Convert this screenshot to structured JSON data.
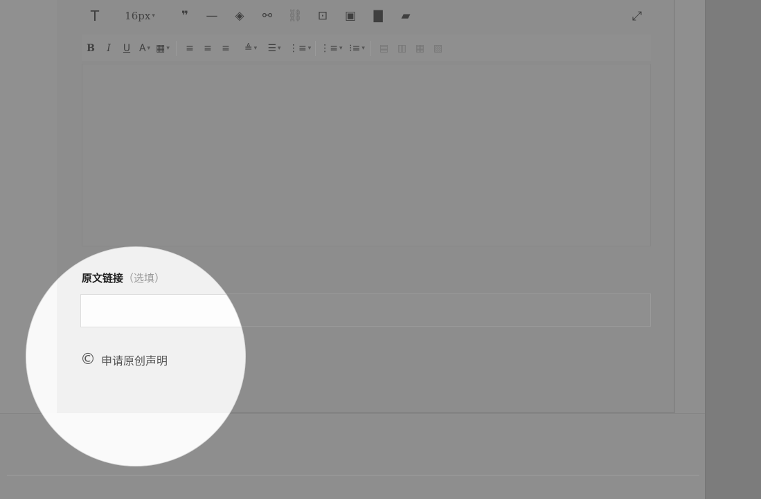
{
  "toolbar": {
    "text_icon": "T",
    "font_size": "16px",
    "font_size_caret": "▾",
    "quote_icon": "❞",
    "hr_icon": "—",
    "eraser_icon": "◈",
    "link_icon": "⚯",
    "unlink_icon": "⛓",
    "video_icon": "⊡",
    "image_icon": "▣",
    "chart_icon": "▇",
    "audio_icon": "▰",
    "fullscreen_icon": "⤢"
  },
  "format_bar": {
    "bold": "B",
    "italic": "I",
    "underline": "U",
    "font_color": "A",
    "bg_color": "▦",
    "align_left": "≡",
    "align_center": "≡",
    "align_right": "≡",
    "valign": "≜",
    "line_height": "☰",
    "indent": "⋮≡",
    "ordered_list": "⋮≡",
    "unordered_list": "⁝≡",
    "float_left": "▤",
    "float_center": "▥",
    "float_right": "▦",
    "float_none": "▧",
    "caret": "▾"
  },
  "source_link": {
    "label": "原文链接",
    "optional": "（选填）",
    "value": ""
  },
  "declare_original": {
    "icon": "©",
    "label": "申请原创声明"
  }
}
